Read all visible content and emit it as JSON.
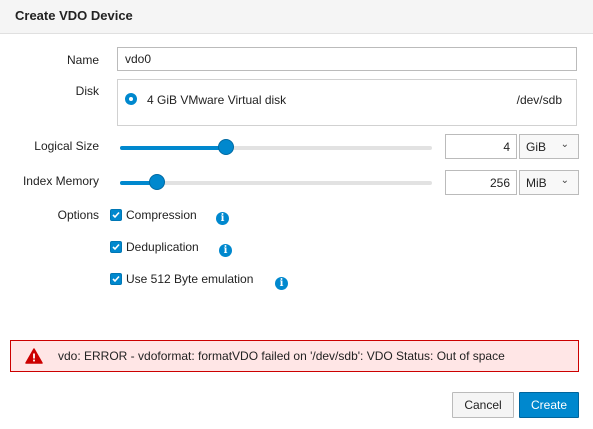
{
  "dialog": {
    "title": "Create VDO Device"
  },
  "form": {
    "name_label": "Name",
    "name_value": "vdo0",
    "disk_label": "Disk",
    "disk": {
      "name": "4 GiB VMware Virtual disk",
      "path": "/dev/sdb",
      "selected": true
    },
    "logical_size": {
      "label": "Logical Size",
      "value": "4",
      "unit": "GiB",
      "slider_fraction": 0.34
    },
    "index_memory": {
      "label": "Index Memory",
      "value": "256",
      "unit": "MiB",
      "slider_fraction": 0.12
    },
    "options_label": "Options",
    "options": [
      {
        "label": "Compression",
        "checked": true
      },
      {
        "label": "Deduplication",
        "checked": true
      },
      {
        "label": "Use 512 Byte emulation",
        "checked": true
      }
    ]
  },
  "alert": {
    "message": "vdo: ERROR - vdoformat: formatVDO failed on '/dev/sdb': VDO Status: Out of space",
    "type": "error"
  },
  "footer": {
    "cancel_label": "Cancel",
    "create_label": "Create"
  },
  "colors": {
    "accent": "#0088ce",
    "error_border": "#cc0000",
    "error_background": "#ffe6e6"
  }
}
